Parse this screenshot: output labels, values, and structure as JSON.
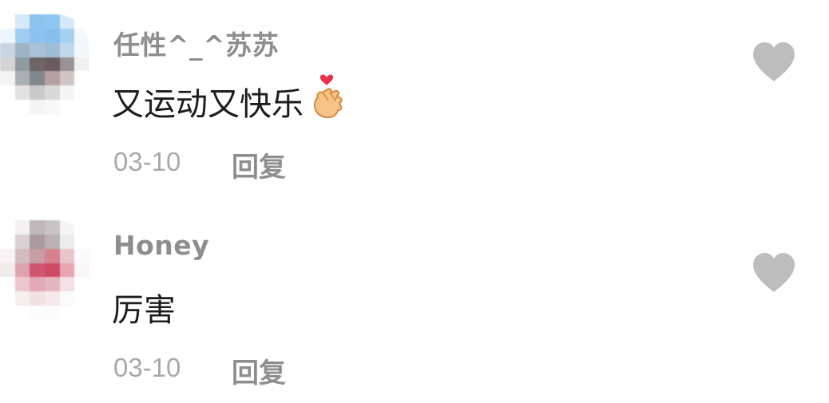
{
  "colors": {
    "username": "#8e8e8e",
    "comment_text": "#1c1c1c",
    "date": "#a8a8a8",
    "reply": "#8e8e8e",
    "heart": "#bdbdbd"
  },
  "comments": [
    {
      "username": "任性^_^苏苏",
      "text": "又运动又快乐",
      "emoji": "finger-heart-emoji",
      "date": "03-10",
      "reply_label": "回复",
      "like_icon": "heart-icon"
    },
    {
      "username": "Honey",
      "text": "厉害",
      "date": "03-10",
      "reply_label": "回复",
      "like_icon": "heart-icon"
    }
  ]
}
